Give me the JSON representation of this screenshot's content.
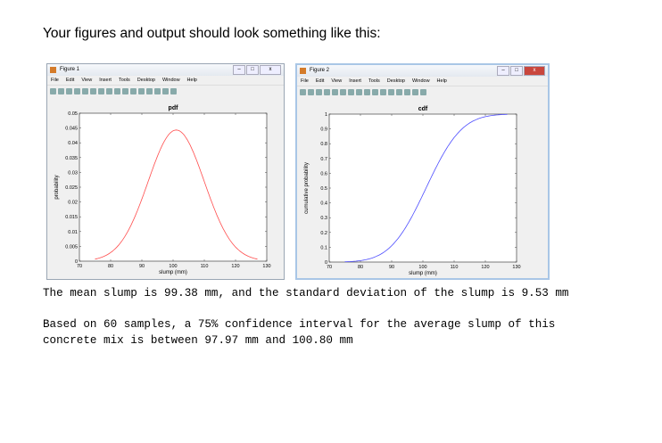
{
  "heading": "Your figures and output should look something like this:",
  "figures": [
    {
      "title": "Figure 1",
      "menu": [
        "File",
        "Edit",
        "View",
        "Insert",
        "Tools",
        "Desktop",
        "Window",
        "Help"
      ],
      "chart_data": {
        "type": "line",
        "title": "pdf",
        "xlabel": "slump (mm)",
        "ylabel": "probability",
        "xlim": [
          70,
          130
        ],
        "ylim": [
          0,
          0.05
        ],
        "xticks": [
          "70",
          "80",
          "90",
          "100",
          "110",
          "120",
          "130"
        ],
        "yticks": [
          "0",
          "0.005",
          "0.01",
          "0.015",
          "0.02",
          "0.025",
          "0.03",
          "0.035",
          "0.04",
          "0.045",
          "0.05"
        ],
        "series": [
          {
            "name": "pdf",
            "kind": "normal-pdf",
            "mean": 101,
            "sd": 9,
            "x_range": [
              75,
              127
            ],
            "color": "#ff4d4d"
          }
        ]
      }
    },
    {
      "title": "Figure 2",
      "menu": [
        "File",
        "Edit",
        "View",
        "Insert",
        "Tools",
        "Desktop",
        "Window",
        "Help"
      ],
      "chart_data": {
        "type": "line",
        "title": "cdf",
        "xlabel": "slump (mm)",
        "ylabel": "cumulative probability",
        "xlim": [
          70,
          130
        ],
        "ylim": [
          0,
          1
        ],
        "xticks": [
          "70",
          "80",
          "90",
          "100",
          "110",
          "120",
          "130"
        ],
        "yticks": [
          "0",
          "0.1",
          "0.2",
          "0.3",
          "0.4",
          "0.5",
          "0.6",
          "0.7",
          "0.8",
          "0.9",
          "1"
        ],
        "series": [
          {
            "name": "cdf",
            "kind": "normal-cdf",
            "mean": 101,
            "sd": 9,
            "x_range": [
              75,
              127
            ],
            "color": "#4d4dff"
          }
        ]
      }
    }
  ],
  "output": {
    "line1": "The mean slump is 99.38 mm, and the standard deviation of the slump is 9.53 mm",
    "line2": "Based on 60 samples, a 75% confidence interval for the average slump of this",
    "line3": "concrete mix is between 97.97 mm and 100.80 mm"
  }
}
